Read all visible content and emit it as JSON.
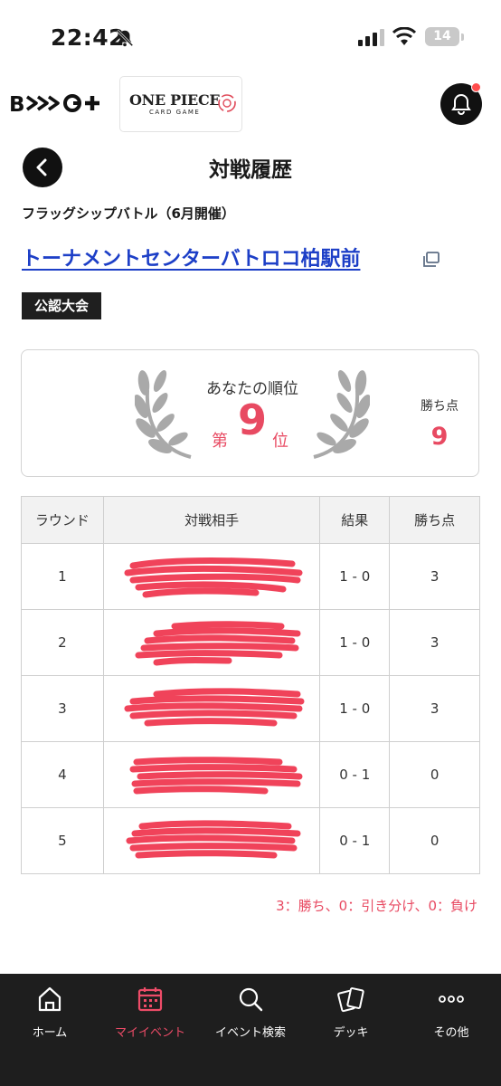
{
  "status": {
    "time": "22:42",
    "battery": "14"
  },
  "header": {
    "logo_text": "B-NEG+",
    "brand_name": "ONE PIECE",
    "brand_sub": "CARD GAME"
  },
  "page": {
    "title": "対戦履歴",
    "event_name": "フラッグシップバトル（6月開催）",
    "venue": "トーナメントセンターバトロコ柏駅前",
    "badge": "公認大会"
  },
  "rank": {
    "caption": "あなたの順位",
    "prefix": "第",
    "value": "9",
    "suffix": "位",
    "points_label": "勝ち点",
    "points_value": "9"
  },
  "table": {
    "headers": [
      "ラウンド",
      "対戦相手",
      "結果",
      "勝ち点"
    ],
    "rows": [
      {
        "round": "1",
        "opponent": "",
        "result": "1 - 0",
        "points": "3"
      },
      {
        "round": "2",
        "opponent": "",
        "result": "1 - 0",
        "points": "3"
      },
      {
        "round": "3",
        "opponent": "",
        "result": "1 - 0",
        "points": "3"
      },
      {
        "round": "4",
        "opponent": "",
        "result": "0 - 1",
        "points": "0"
      },
      {
        "round": "5",
        "opponent": "",
        "result": "0 - 1",
        "points": "0"
      }
    ]
  },
  "legend": "3：勝ち、0：引き分け、0：負け",
  "nav": {
    "items": [
      {
        "label": "ホーム",
        "icon": "home-icon"
      },
      {
        "label": "マイイベント",
        "icon": "calendar-icon"
      },
      {
        "label": "イベント検索",
        "icon": "search-icon"
      },
      {
        "label": "デッキ",
        "icon": "cards-icon"
      },
      {
        "label": "その他",
        "icon": "more-icon"
      }
    ],
    "active_index": 1
  },
  "colors": {
    "accent": "#e84a62",
    "link": "#1d3fc7",
    "redaction": "#f0435a",
    "nav_bg": "#1e1e1e"
  }
}
